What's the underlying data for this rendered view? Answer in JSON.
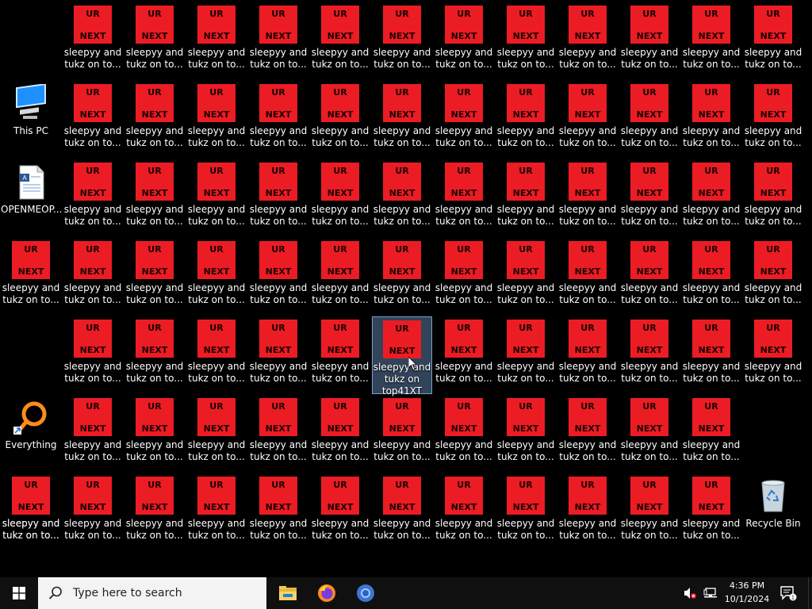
{
  "desktop": {
    "ur_top": "UR",
    "ur_bottom": "NEXT",
    "file_label_line1": "sleepyy and",
    "file_label_line2": "tukz on to...",
    "selected_label_line1": "sleepyy and",
    "selected_label_line2": "tukz on",
    "selected_label_line3": "top41XT",
    "this_pc": {
      "label": "This PC",
      "icon": "computer-icon"
    },
    "openme": {
      "label": "OPENMEOP...",
      "icon": "document-icon"
    },
    "everything": {
      "label": "Everything",
      "icon": "search-magnifier-icon"
    },
    "recycle_bin": {
      "label": "Recycle Bin",
      "icon": "recycle-bin-icon"
    }
  },
  "taskbar": {
    "search_placeholder": "Type here to search",
    "time": "4:36 PM",
    "date": "10/1/2024",
    "pinned": [
      "file-explorer-icon",
      "firefox-icon",
      "chrome-icon"
    ],
    "notification_count": "1"
  },
  "colors": {
    "icon_red": "#ec1c24",
    "taskbar": "#101010",
    "selection": "#6e96c8"
  }
}
